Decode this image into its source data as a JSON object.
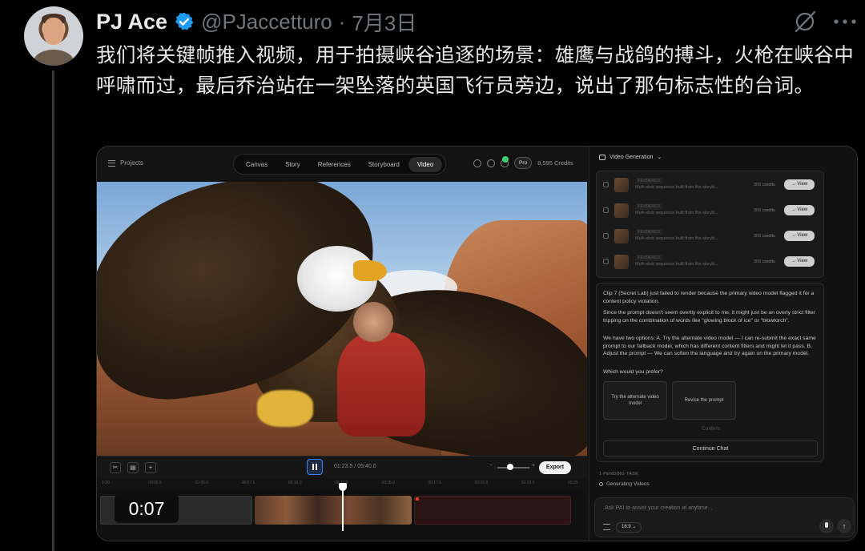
{
  "tweet": {
    "display_name": "PJ Ace",
    "handle": "@PJaccetturo",
    "separator": "·",
    "date": "7月3日",
    "text": "我们将关键帧推入视频，用于拍摄峡谷追逐的场景：雄鹰与战鸽的搏斗，火枪在峡谷中呼啸而过，最后乔治站在一架坠落的英国飞行员旁边，说出了那句标志性的台词。",
    "verified_color": "#1d9bf0",
    "icons": [
      "verified-badge-icon",
      "grok-icon",
      "more-icon"
    ]
  },
  "app": {
    "projects_label": "Projects",
    "tabs": [
      {
        "label": "Canvas"
      },
      {
        "label": "Story"
      },
      {
        "label": "References"
      },
      {
        "label": "Storyboard"
      },
      {
        "label": "Video",
        "active": true
      }
    ],
    "pro_label": "Pro",
    "credits": "8,595 Credits",
    "timeline": {
      "timecode": "01:23.5 / 05:40.0",
      "export_label": "Export",
      "current_time": "0:07",
      "zoom_minus": "−",
      "zoom_plus": "+",
      "ruler_ticks": [
        "0:00",
        "00:02.5",
        "00:05.0",
        "00:07.5",
        "00:10.0",
        "00:12.5",
        "00:15.0",
        "00:17.5",
        "00:20.0",
        "00:22.5",
        "00:25"
      ],
      "zoom_level": 0.4
    },
    "panel": {
      "title": "Video Generation",
      "tasks": [
        {
          "status": "RENDERED",
          "description": "Multi-shot sequence built from the storyb...",
          "credits": "300 credits",
          "action": "→ View"
        },
        {
          "status": "RENDERED",
          "description": "Multi-shot sequence built from the storyb...",
          "credits": "300 credits",
          "action": "→ View"
        },
        {
          "status": "RENDERED",
          "description": "Multi-shot sequence built from the storyb...",
          "credits": "300 credits",
          "action": "→ View"
        },
        {
          "status": "RENDERED",
          "description": "Multi-shot sequence built from the storyb...",
          "credits": "300 credits",
          "action": "→ View"
        }
      ],
      "message": {
        "p1": "Clip 7 (Secret Lab) just failed to render because the primary video model flagged it for a content policy violation.",
        "p2": "Since the prompt doesn't seem overtly explicit to me, it might just be an overly strict filter tripping on the combination of words like \"glowing block of ice\" or \"blowtorch\".",
        "p3": "We have two options: A. Try the alternate video model — I can re-submit the exact same prompt to our fallback model, which has different content filters and might let it pass. B. Adjust the prompt — We can soften the language and try again on the primary model.",
        "p4": "Which would you prefer?",
        "option_a": "Try the alternate video model",
        "option_b": "Revise the prompt",
        "confirm": "Confirm",
        "continue": "Continue Chat"
      },
      "pending_label": "1 PENDING TASK",
      "pending_item": "Generating Videos",
      "input_placeholder": "Ask PAI to assist your creation at anytime...",
      "aspect_ratio": "16:9",
      "send_glyph": "↑"
    }
  }
}
